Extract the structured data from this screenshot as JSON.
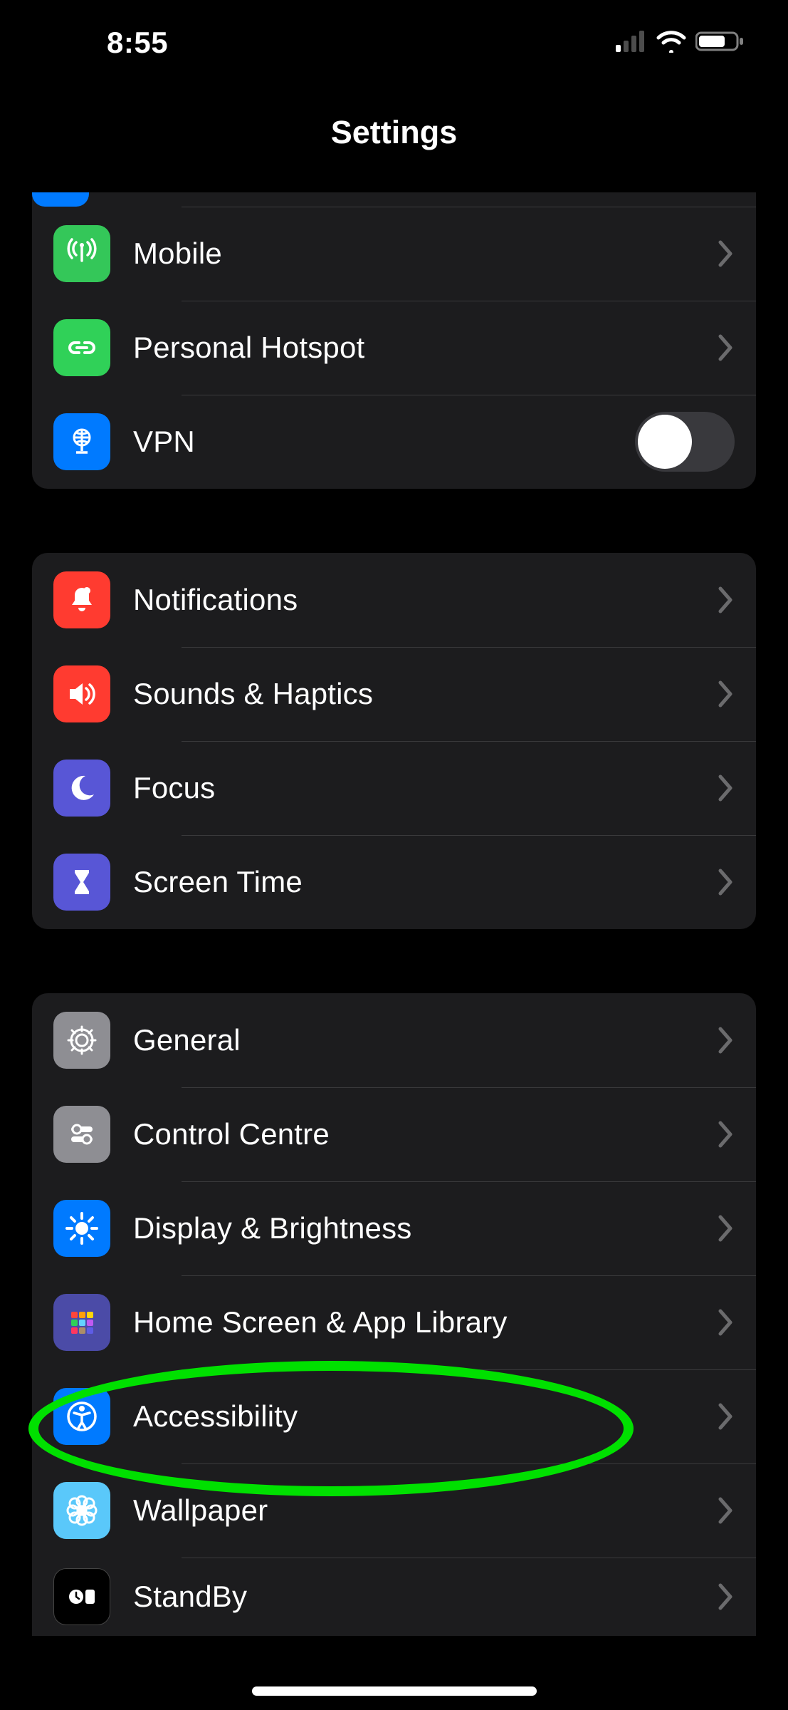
{
  "status": {
    "time": "8:55"
  },
  "header": {
    "title": "Settings"
  },
  "groups": [
    {
      "rows": [
        {
          "key": "stub",
          "label": ""
        },
        {
          "key": "mobile",
          "label": "Mobile"
        },
        {
          "key": "hotspot",
          "label": "Personal Hotspot"
        },
        {
          "key": "vpn",
          "label": "VPN",
          "toggle": false
        }
      ]
    },
    {
      "rows": [
        {
          "key": "notifications",
          "label": "Notifications"
        },
        {
          "key": "sounds",
          "label": "Sounds & Haptics"
        },
        {
          "key": "focus",
          "label": "Focus"
        },
        {
          "key": "screentime",
          "label": "Screen Time"
        }
      ]
    },
    {
      "rows": [
        {
          "key": "general",
          "label": "General"
        },
        {
          "key": "controlcentre",
          "label": "Control Centre"
        },
        {
          "key": "display",
          "label": "Display & Brightness"
        },
        {
          "key": "homescreen",
          "label": "Home Screen & App Library"
        },
        {
          "key": "accessibility",
          "label": "Accessibility",
          "highlighted": true
        },
        {
          "key": "wallpaper",
          "label": "Wallpaper"
        },
        {
          "key": "standby",
          "label": "StandBy"
        }
      ]
    }
  ]
}
